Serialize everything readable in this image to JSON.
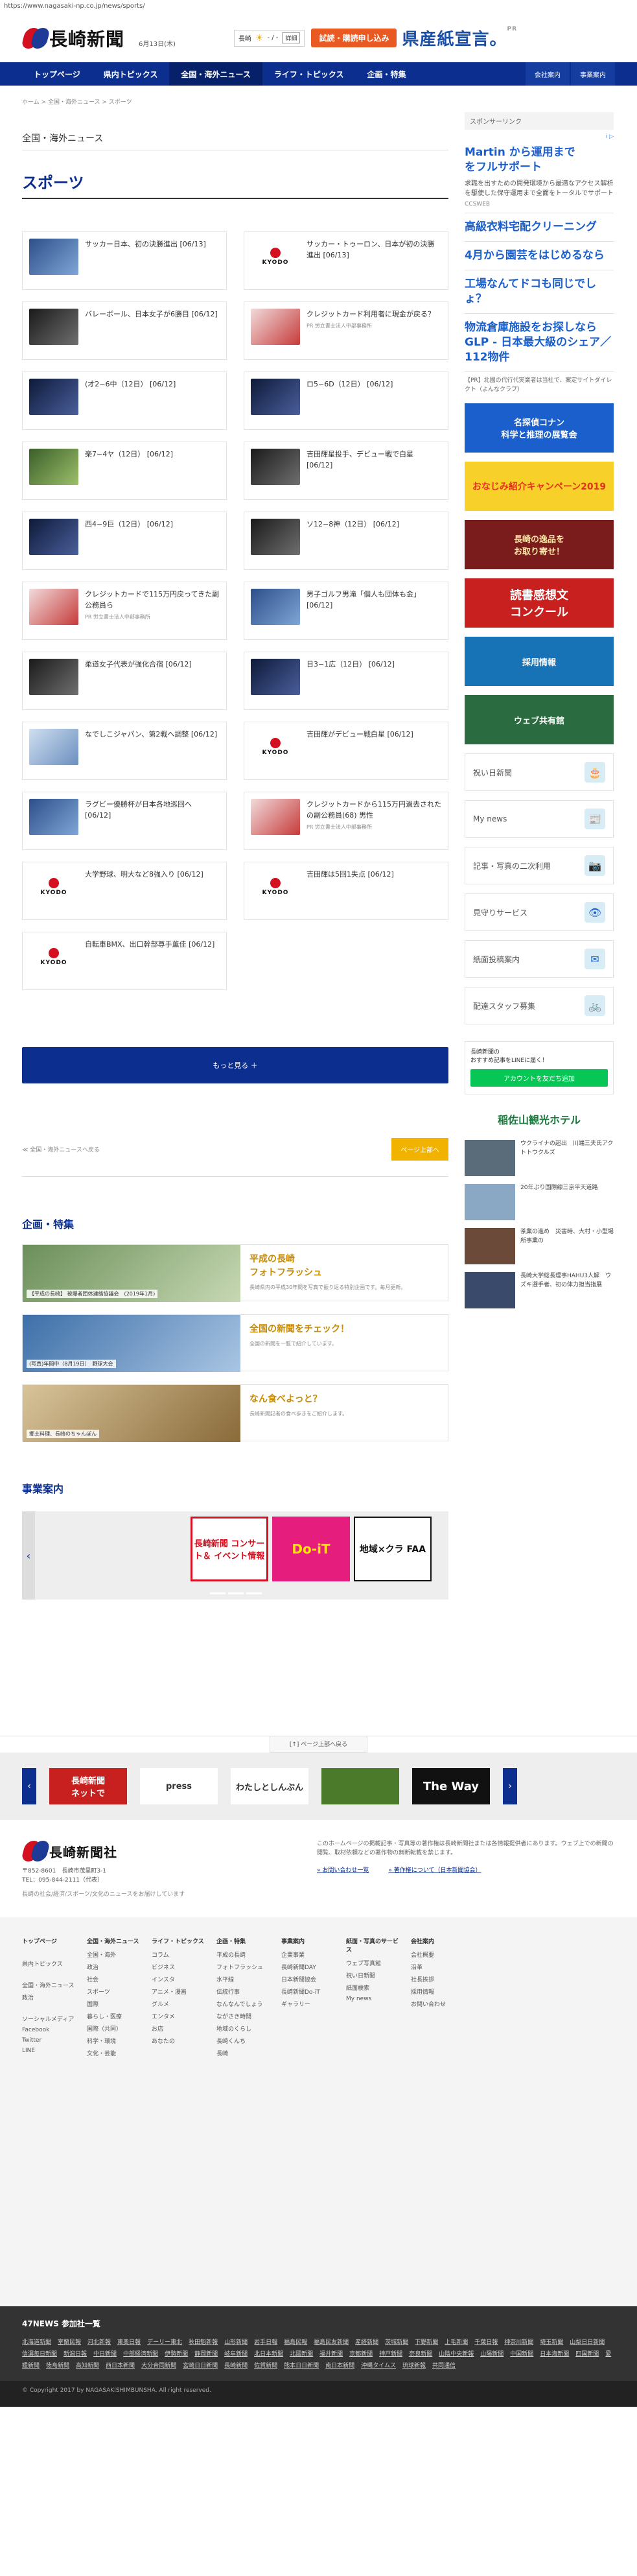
{
  "url": "https://www.nagasaki-np.co.jp/news/sports/",
  "header": {
    "logo_text": "長崎新聞",
    "date": "6月13日(木)",
    "weather_label": "長崎",
    "weather_temp": "- / -",
    "weather_detail": "詳細",
    "trial_button": "試読・購読申し込み",
    "ad_banner": "県産紙宣言。",
    "ad_banner_mark": "PR"
  },
  "nav": {
    "items": [
      "トップページ",
      "県内トピックス",
      "全国・海外ニュース",
      "ライフ・トピックス",
      "企画・特集"
    ],
    "right": [
      "会社案内",
      "事業案内"
    ]
  },
  "breadcrumb": "ホーム > 全国・海外ニュース > スポーツ",
  "main": {
    "section_label": "全国・海外ニュース",
    "page_title": "スポーツ",
    "articles": [
      {
        "title": "サッカー日本、初の決勝進出 [06/13]",
        "thumb": "t-blue",
        "pr": ""
      },
      {
        "title": "サッカー・トゥーロン、日本が初の決勝進出 [06/13]",
        "thumb": "kyodo",
        "pr": ""
      },
      {
        "title": "バレーボール、日本女子が6勝目 [06/12]",
        "thumb": "t-dark",
        "pr": ""
      },
      {
        "title": "クレジットカード利用者に現金が戻る？",
        "thumb": "t-paper",
        "pr": "PR 労立書士法人中部事務所"
      },
      {
        "title": "(才2−6中（12日） [06/12]",
        "thumb": "t-night",
        "pr": ""
      },
      {
        "title": "ロ5−6D（12日） [06/12]",
        "thumb": "t-night",
        "pr": ""
      },
      {
        "title": "楽7−4ヤ（12日） [06/12]",
        "thumb": "t-field",
        "pr": ""
      },
      {
        "title": "吉田輝星投手、デビュー戦で白星 [06/12]",
        "thumb": "t-dark",
        "pr": ""
      },
      {
        "title": "西4−9巨（12日） [06/12]",
        "thumb": "t-night",
        "pr": ""
      },
      {
        "title": "ソ12−8神（12日） [06/12]",
        "thumb": "t-dark",
        "pr": ""
      },
      {
        "title": "クレジットカードで115万円戻ってきた副公務員ら",
        "thumb": "t-paper",
        "pr": "PR 労立書士法人中部事務所"
      },
      {
        "title": "男子ゴルフ男滝「個人も団体も金」 [06/12]",
        "thumb": "t-blue",
        "pr": ""
      },
      {
        "title": "柔道女子代表が強化合宿 [06/12]",
        "thumb": "t-dark",
        "pr": ""
      },
      {
        "title": "日3−1広（12日） [06/12]",
        "thumb": "t-night",
        "pr": ""
      },
      {
        "title": "なでしこジャパン、第2戦へ調整 [06/12]",
        "thumb": "t-ice",
        "pr": ""
      },
      {
        "title": "吉田輝がデビュー戦白星 [06/12]",
        "thumb": "kyodo",
        "pr": ""
      },
      {
        "title": "ラグビー優勝杯が日本各地巡回へ [06/12]",
        "thumb": "t-blue",
        "pr": ""
      },
      {
        "title": "クレジットカードから115万円過去されたの副公務員(68) 男性",
        "thumb": "t-paper",
        "pr": "PR 労立書士法人中部事務所"
      },
      {
        "title": "大学野球、明大など8強入り [06/12]",
        "thumb": "kyodo",
        "pr": ""
      },
      {
        "title": "吉田輝は5回1失点 [06/12]",
        "thumb": "kyodo",
        "pr": ""
      },
      {
        "title": "自転車BMX、出口幹部尊手薫佳 [06/12]",
        "thumb": "kyodo",
        "pr": ""
      }
    ],
    "kyodo_label": "KYODO",
    "more_button": "もっと見る ＋",
    "back_link": "≪ 全国・海外ニュースへ戻る",
    "top_button": "ページ上部へ"
  },
  "features": {
    "heading": "企画・特集",
    "items": [
      {
        "caption": "【平成の長崎】 被爆者団体連絡協議会　(2019年1月)",
        "title": "平成の長崎\nフォトフラッシュ",
        "desc": "長崎県内の平成30年間を写真で振り返る特別企画です。毎月更新。"
      },
      {
        "caption": "(写真)年間中（8月19日）　野球大会",
        "title": "全国の新聞をチェック！",
        "desc": "全国の新聞を一覧で紹介しています。"
      },
      {
        "caption": "郷土料理、長崎のちゃんぽん",
        "title": "なん食べよっと？",
        "desc": "長崎新聞記者の食べ歩きをご紹介します。"
      }
    ]
  },
  "jigyo": {
    "heading": "事業案内",
    "tiles": [
      "長崎新聞\nコンサート＆\nイベント情報",
      "Do-iT",
      "地域×クラ\nFAA"
    ]
  },
  "sidebar": {
    "head": "スポンサーリンク",
    "ad_info": "i ▷",
    "ad_main_title": "Martin から運用まで\nをフルサポート",
    "ad_main_text": "求職を出すための開発環境から最適なアクセス解析を駆使した保守運用まで全面をトータルでサポート",
    "ad_main_source": "CCSWEB",
    "ads": [
      "高級衣料宅配クリーニング",
      "4月から園芸をはじめるなら",
      "工場なんてドコも同じでしょ？",
      "物流倉庫施設をお探しならGLP - 日本最大級のシェア／112物件"
    ],
    "ad_note": "【PR】北國の代行代実業者は当社で、案定サイトダイレクト（よんなクラブ）",
    "banners": [
      "名探偵コナン\n科学と推理の展覧会",
      "おなじみ紹介キャンペーン2019",
      "長崎の逸品を\nお取り寄せ！",
      "読書感想文\nコンクール",
      "採用情報",
      "ウェブ共有館"
    ],
    "links": [
      "祝い日新聞",
      "My news",
      "記事・写真の二次利用",
      "見守りサービス",
      "紙面投稿案内",
      "配達スタッフ募集"
    ],
    "line_text": "長崎新聞の\nおすすめ記事をLINEに届く！",
    "line_button": "アカウントを友だち追加",
    "hotel": "稲佐山観光ホテル",
    "news": [
      "ウクライナの超出　川端三夫氏アクトトウクルズ",
      "20年ぶり国際線三京平天道路",
      "茶業の進め　災害時、大村・小型場所事業の",
      "長崎大学総長理事HAHU3人解　ウズキ選手者、初の体力担当指展"
    ]
  },
  "footer": {
    "pagetop": "[↑] ページ上部へ戻る",
    "banners": [
      "長崎新聞\nネットで",
      "press",
      "わたしとしんぶん",
      "",
      "The Way"
    ],
    "logo_text": "長崎新聞社",
    "address": "〒852-8601　長崎市茂里町3-1\nTEL：095-844-2111（代表）",
    "tagline": "長崎の社会/経済/スポーツ/文化のニュースをお届けしています",
    "notice": "このホームページの掲載記事・写真等の著作権は長崎新聞社または各情報提供者にあります。ウェブ上での新聞の閲覧、取材依頼などの著作物の無断転載を禁じます。",
    "links": [
      "» お問い合わせ一覧",
      "» 著作権について（日本新聞協会）"
    ],
    "sitemap": [
      {
        "h": "トップページ",
        "items": [
          "",
          "県内トピックス",
          "",
          "全国・海外ニュース",
          "政治",
          "",
          "ソーシャルメディア",
          "Facebook",
          "Twitter",
          "LINE"
        ]
      },
      {
        "h": "全国・海外ニュース",
        "items": [
          "全国・海外",
          "政治",
          "社会",
          "スポーツ",
          "国際",
          "暮らし・医療",
          "国際（共同）",
          "科学・環境",
          "文化・芸能"
        ]
      },
      {
        "h": "ライフ・トピックス",
        "items": [
          "コラム",
          "ビジネス",
          "インスタ",
          "アニメ・漫画",
          "グルメ",
          "エンタメ",
          "お店",
          "あなたの"
        ]
      },
      {
        "h": "企画・特集",
        "items": [
          "平成の長崎",
          "フォトフラッシュ",
          "水平線",
          "伝統行事",
          "なんなんでしょう",
          "ながさき時間",
          "地域のくらし",
          "長崎くんち",
          "長崎"
        ]
      },
      {
        "h": "事業案内",
        "items": [
          "企業事業",
          "長崎新聞DAY",
          "日本新聞協会",
          "長崎新聞Do-iT",
          "ギャラリー"
        ]
      },
      {
        "h": "紙面・写真のサービス",
        "items": [
          "ウェブ写真館",
          "祝い日新聞",
          "紙面検索",
          "My news"
        ]
      },
      {
        "h": "会社案内",
        "items": [
          "会社概要",
          "沿革",
          "社長挨拶",
          "採用情報",
          "お問い合わせ"
        ]
      }
    ],
    "f47_heading": "47NEWS 参加社一覧",
    "f47_list": [
      "北海道新聞",
      "室蘭民報",
      "河北新報",
      "東奥日報",
      "デーリー東北",
      "秋田魁新報",
      "山形新聞",
      "岩手日報",
      "福島民報",
      "福島民友新聞",
      "産経新聞",
      "茨城新聞",
      "下野新聞",
      "上毛新聞",
      "千葉日報",
      "神奈川新聞",
      "埼玉新聞",
      "山梨日日新聞",
      "信濃毎日新聞",
      "新潟日報",
      "中日新聞",
      "中部経済新聞",
      "伊勢新聞",
      "静岡新聞",
      "岐阜新聞",
      "北日本新聞",
      "北國新聞",
      "福井新聞",
      "京都新聞",
      "神戸新聞",
      "奈良新聞",
      "山陰中央新報",
      "山陽新聞",
      "中国新聞",
      "日本海新聞",
      "四国新聞",
      "愛媛新聞",
      "徳島新聞",
      "高知新聞",
      "西日本新聞",
      "大分合同新聞",
      "宮崎日日新聞",
      "長崎新聞",
      "佐賀新聞",
      "熊本日日新聞",
      "南日本新聞",
      "沖縄タイムス",
      "琉球新報",
      "共同通信"
    ],
    "copyright": "© Copyright 2017 by NAGASAKISHIMBUNSHA.  All right reserved."
  }
}
